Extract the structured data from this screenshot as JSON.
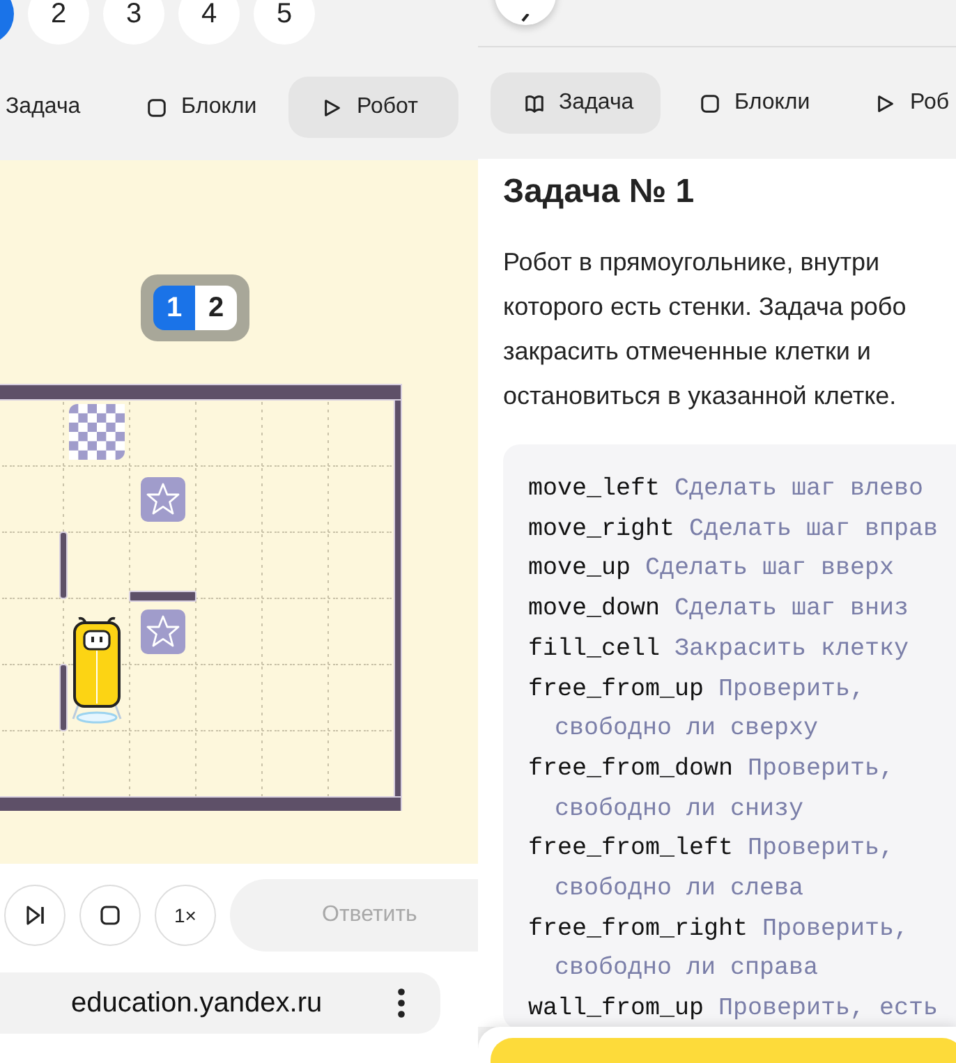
{
  "robot_pane": {
    "pages": [
      {
        "selected": true
      },
      {
        "label": "2",
        "selected": false
      },
      {
        "label": "3",
        "selected": false
      },
      {
        "label": "4",
        "selected": false
      },
      {
        "label": "5",
        "selected": false
      }
    ],
    "tabs": [
      {
        "label": "Задача",
        "selected": false
      },
      {
        "kind": "blockly",
        "label": "Блокли",
        "selected": false
      },
      {
        "kind": "robot",
        "label": "Робот",
        "selected": true
      }
    ],
    "solutions": [
      {
        "label": "1",
        "selected": true
      },
      {
        "label": "2",
        "selected": false
      }
    ],
    "board": {
      "rows": [
        {
          "cells": [
            {
              "kind": "empty",
              "wall_left": false,
              "wall_top": false
            },
            {
              "kind": "finish",
              "wall_left": false,
              "wall_top": false
            },
            {
              "kind": "empty",
              "wall_left": false,
              "wall_top": false
            },
            {
              "kind": "empty",
              "wall_left": false,
              "wall_top": false
            },
            {
              "kind": "empty",
              "wall_left": false,
              "wall_top": false
            },
            {
              "kind": "empty",
              "wall_left": false,
              "wall_top": false
            }
          ]
        },
        {
          "cells": [
            {
              "kind": "empty",
              "wall_left": false,
              "wall_top": false
            },
            {
              "kind": "empty",
              "wall_left": false,
              "wall_top": false
            },
            {
              "kind": "star",
              "wall_left": false,
              "wall_top": false
            },
            {
              "kind": "empty",
              "wall_left": false,
              "wall_top": false
            },
            {
              "kind": "empty",
              "wall_left": false,
              "wall_top": false
            },
            {
              "kind": "empty",
              "wall_left": false,
              "wall_top": false
            }
          ]
        },
        {
          "cells": [
            {
              "kind": "empty",
              "wall_left": false,
              "wall_top": false
            },
            {
              "kind": "empty",
              "wall_left": true,
              "wall_top": false
            },
            {
              "kind": "empty",
              "wall_left": false,
              "wall_top": false
            },
            {
              "kind": "empty",
              "wall_left": false,
              "wall_top": false
            },
            {
              "kind": "empty",
              "wall_left": false,
              "wall_top": false
            },
            {
              "kind": "empty",
              "wall_left": false,
              "wall_top": false
            }
          ]
        },
        {
          "cells": [
            {
              "kind": "empty",
              "wall_left": false,
              "wall_top": false
            },
            {
              "kind": "empty",
              "wall_left": false,
              "wall_top": false
            },
            {
              "kind": "star",
              "wall_left": false,
              "wall_top": true
            },
            {
              "kind": "empty",
              "wall_left": false,
              "wall_top": false
            },
            {
              "kind": "empty",
              "wall_left": false,
              "wall_top": false
            },
            {
              "kind": "empty",
              "wall_left": false,
              "wall_top": false
            }
          ]
        },
        {
          "cells": [
            {
              "kind": "empty",
              "wall_left": false,
              "wall_top": false
            },
            {
              "kind": "robot",
              "wall_left": true,
              "wall_top": false
            },
            {
              "kind": "empty",
              "wall_left": false,
              "wall_top": false
            },
            {
              "kind": "empty",
              "wall_left": false,
              "wall_top": false
            },
            {
              "kind": "empty",
              "wall_left": false,
              "wall_top": false
            },
            {
              "kind": "empty",
              "wall_left": false,
              "wall_top": false
            }
          ]
        },
        {
          "cells": [
            {
              "kind": "empty",
              "wall_left": false,
              "wall_top": false
            },
            {
              "kind": "empty",
              "wall_left": false,
              "wall_top": false
            },
            {
              "kind": "empty",
              "wall_left": false,
              "wall_top": false
            },
            {
              "kind": "empty",
              "wall_left": false,
              "wall_top": false
            },
            {
              "kind": "empty",
              "wall_left": false,
              "wall_top": false
            },
            {
              "kind": "empty",
              "wall_left": false,
              "wall_top": false
            }
          ]
        }
      ]
    },
    "controls": [
      {
        "kind": "step"
      },
      {
        "kind": "stop"
      },
      {
        "kind": "speed",
        "label": "1×"
      }
    ],
    "answer_button": {
      "label": "Ответить",
      "disabled": true
    },
    "address_bar": {
      "url": "education.yandex.ru"
    }
  },
  "task_pane": {
    "tabs": [
      {
        "kind": "task",
        "label": "Задача",
        "selected": true
      },
      {
        "kind": "blockly",
        "label": "Блокли",
        "selected": false
      },
      {
        "kind": "robot",
        "label": "Роб",
        "selected": false
      }
    ],
    "title": "Задача № 1",
    "description_lines": [
      "Робот в прямоугольнике, внутри",
      "которого есть стенки. Задача робо",
      "закрасить отмеченные клетки и",
      "остановиться в указанной клетке."
    ],
    "commands": [
      {
        "name": "move_left",
        "description": [
          "Сделать шаг влево"
        ]
      },
      {
        "name": "move_right",
        "description": [
          "Сделать шаг вправ"
        ]
      },
      {
        "name": "move_up",
        "description": [
          "Сделать шаг вверх"
        ]
      },
      {
        "name": "move_down",
        "description": [
          "Сделать шаг вниз"
        ]
      },
      {
        "name": "fill_cell",
        "description": [
          "Закрасить клетку"
        ]
      },
      {
        "name": "free_from_up",
        "description": [
          "Проверить,",
          "свободно ли сверху"
        ]
      },
      {
        "name": "free_from_down",
        "description": [
          "Проверить,",
          "свободно ли снизу"
        ]
      },
      {
        "name": "free_from_left",
        "description": [
          "Проверить,",
          "свободно ли слева"
        ]
      },
      {
        "name": "free_from_right",
        "description": [
          "Проверить,",
          "свободно ли справа"
        ]
      },
      {
        "name": "wall_from_up",
        "description": [
          "Проверить, есть"
        ]
      }
    ]
  }
}
